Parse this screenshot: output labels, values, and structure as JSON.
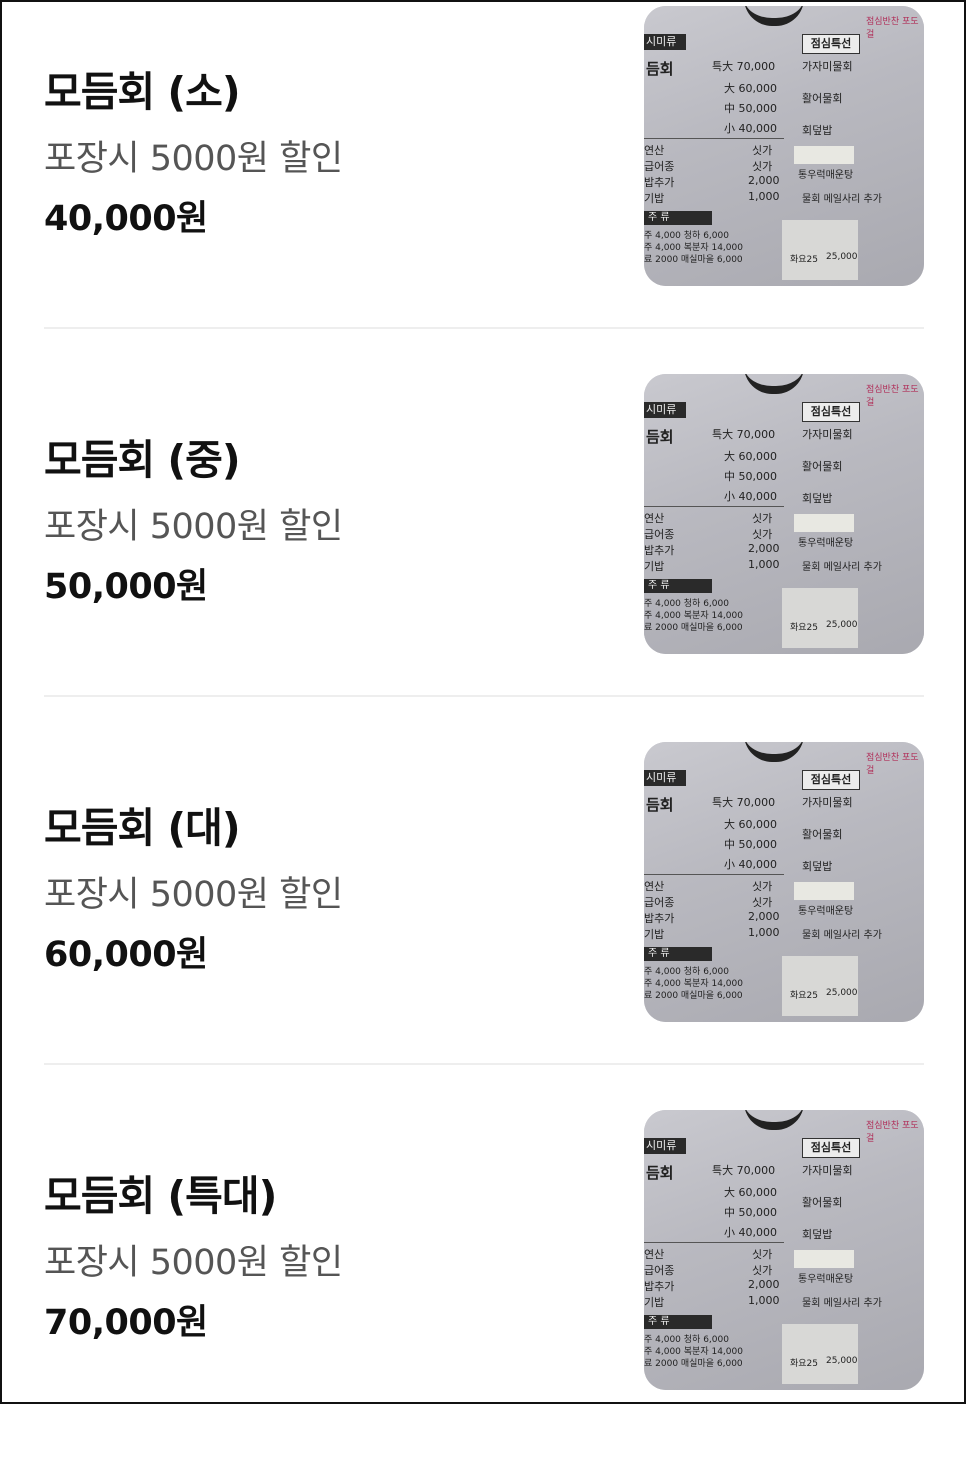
{
  "items": [
    {
      "title": "모듬회 (소)",
      "desc": "포장시 5000원 할인",
      "price": "40,000원"
    },
    {
      "title": "모듬회 (중)",
      "desc": "포장시 5000원 할인",
      "price": "50,000원"
    },
    {
      "title": "모듬회 (대)",
      "desc": "포장시 5000원 할인",
      "price": "60,000원"
    },
    {
      "title": "모듬회 (특대)",
      "desc": "포장시 5000원 할인",
      "price": "70,000원"
    }
  ],
  "board": {
    "header": "시미류",
    "special": "점심특선",
    "name": "듬회",
    "prices": [
      "특大 70,000",
      "大 60,000",
      "中 50,000",
      "小 40,000"
    ],
    "right": [
      "가자미물회",
      "활어물회",
      "회덮밥",
      "물회 메일사리 추가"
    ],
    "left": [
      "연산",
      "급어종",
      "밥추가",
      "기밥"
    ],
    "mid": [
      "싯가",
      "싯가",
      "2,000",
      "1,000"
    ],
    "section": "주  류",
    "drinks": [
      "주 4,000  청하  6,000",
      "주 4,000  복분자 14,000",
      "료 2000  매실마을 6,000"
    ],
    "bottom": [
      "화요25",
      "25,000"
    ],
    "tang": "통우럭매운탕"
  }
}
